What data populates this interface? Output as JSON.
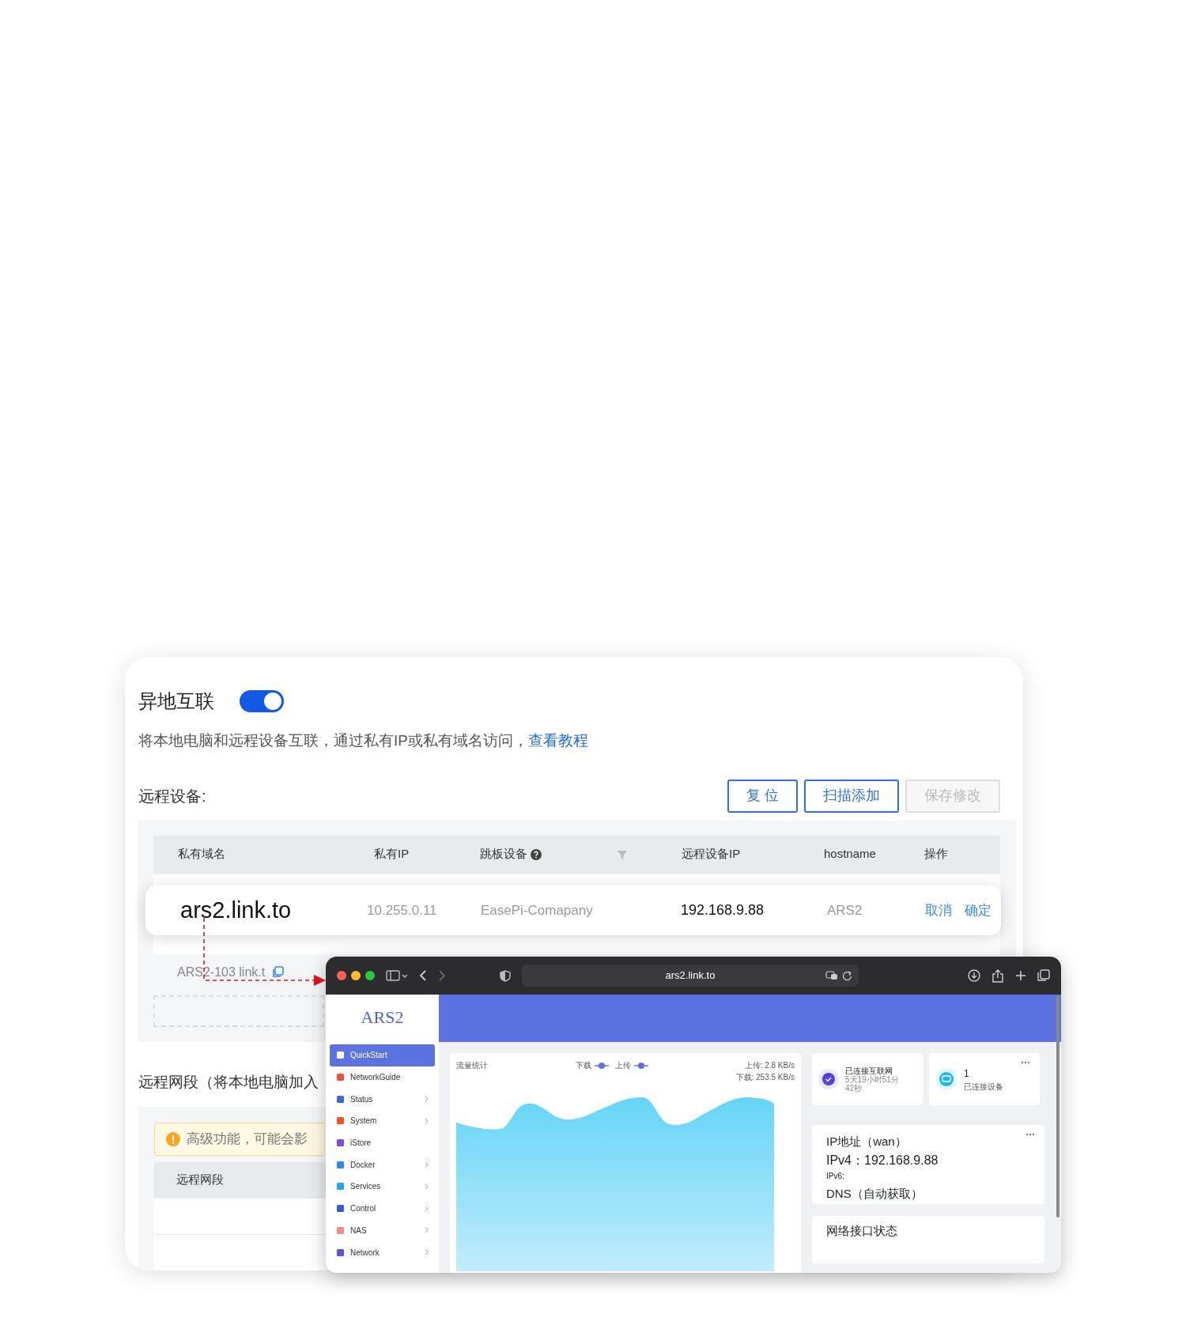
{
  "section": {
    "title": "异地互联",
    "enabled": true,
    "description": "将本地电脑和远程设备互联，通过私有IP或私有域名访问，",
    "tutorial_link": "查看教程"
  },
  "remote_devices": {
    "label": "远程设备:",
    "buttons": [
      {
        "label": "复 位",
        "disabled": false
      },
      {
        "label": "扫描添加",
        "disabled": false
      },
      {
        "label": "保存修改",
        "disabled": true
      }
    ],
    "columns": [
      {
        "label": "私有域名",
        "kind": "plain"
      },
      {
        "label": "私有IP",
        "kind": "plain"
      },
      {
        "label": "跳板设备",
        "kind": "help"
      },
      {
        "label": "远程设备IP",
        "kind": "plain"
      },
      {
        "label": "hostname",
        "kind": "plain"
      },
      {
        "label": "操作",
        "kind": "plain"
      }
    ],
    "highlighted_row": {
      "domain": "ars2.link.to",
      "ip": "10.255.0.11",
      "jump_device": "EasePi-Comapany",
      "remote_ip": "192.168.9.88",
      "hostname": "ARS2",
      "actions": [
        "取消",
        "确定"
      ]
    },
    "partial_row": {
      "domain": "ARS2-103 link.t"
    }
  },
  "remote_segments": {
    "title": "远程网段（将本地电脑加入",
    "warning": "高级功能，可能会影",
    "column": "远程网段"
  },
  "browser": {
    "url": "ars2.link.to",
    "logo": "ARS2",
    "menu": [
      {
        "label": "QuickStart",
        "selected": true,
        "submenu": false,
        "color": "#ffffff"
      },
      {
        "label": "NetworkGuide",
        "selected": false,
        "submenu": false,
        "color": "#f0533d"
      },
      {
        "label": "Status",
        "selected": false,
        "submenu": true,
        "color": "#3d66d9"
      },
      {
        "label": "System",
        "selected": false,
        "submenu": true,
        "color": "#f0532d"
      },
      {
        "label": "iStore",
        "selected": false,
        "submenu": false,
        "color": "#7b4fd6"
      },
      {
        "label": "Docker",
        "selected": false,
        "submenu": true,
        "color": "#2f8be6"
      },
      {
        "label": "Services",
        "selected": false,
        "submenu": true,
        "color": "#22a7f0"
      },
      {
        "label": "Control",
        "selected": false,
        "submenu": true,
        "color": "#3f5bd1"
      },
      {
        "label": "NAS",
        "selected": false,
        "submenu": true,
        "color": "#f28b8b"
      },
      {
        "label": "Network",
        "selected": false,
        "submenu": true,
        "color": "#6a4fd6"
      }
    ],
    "traffic": {
      "title": "流量统计",
      "legend": [
        {
          "label": "下载",
          "color": "#5b72e0"
        },
        {
          "label": "上传",
          "color": "#5b72e0"
        }
      ],
      "upload": "上传: 2.8 KB/s",
      "download": "下载: 253.5 KB/s"
    },
    "internet": {
      "status": "已连接互联网",
      "uptime": "5天19小时51分42秒"
    },
    "devices": {
      "count": "1",
      "label": "已连接设备"
    },
    "ip_card": {
      "title": "IP地址（wan）",
      "ipv4": "IPv4：192.168.9.88",
      "ipv6": "IPv6:",
      "dns": "DNS（自动获取）"
    },
    "interfaces": {
      "title": "网络接口状态"
    }
  }
}
